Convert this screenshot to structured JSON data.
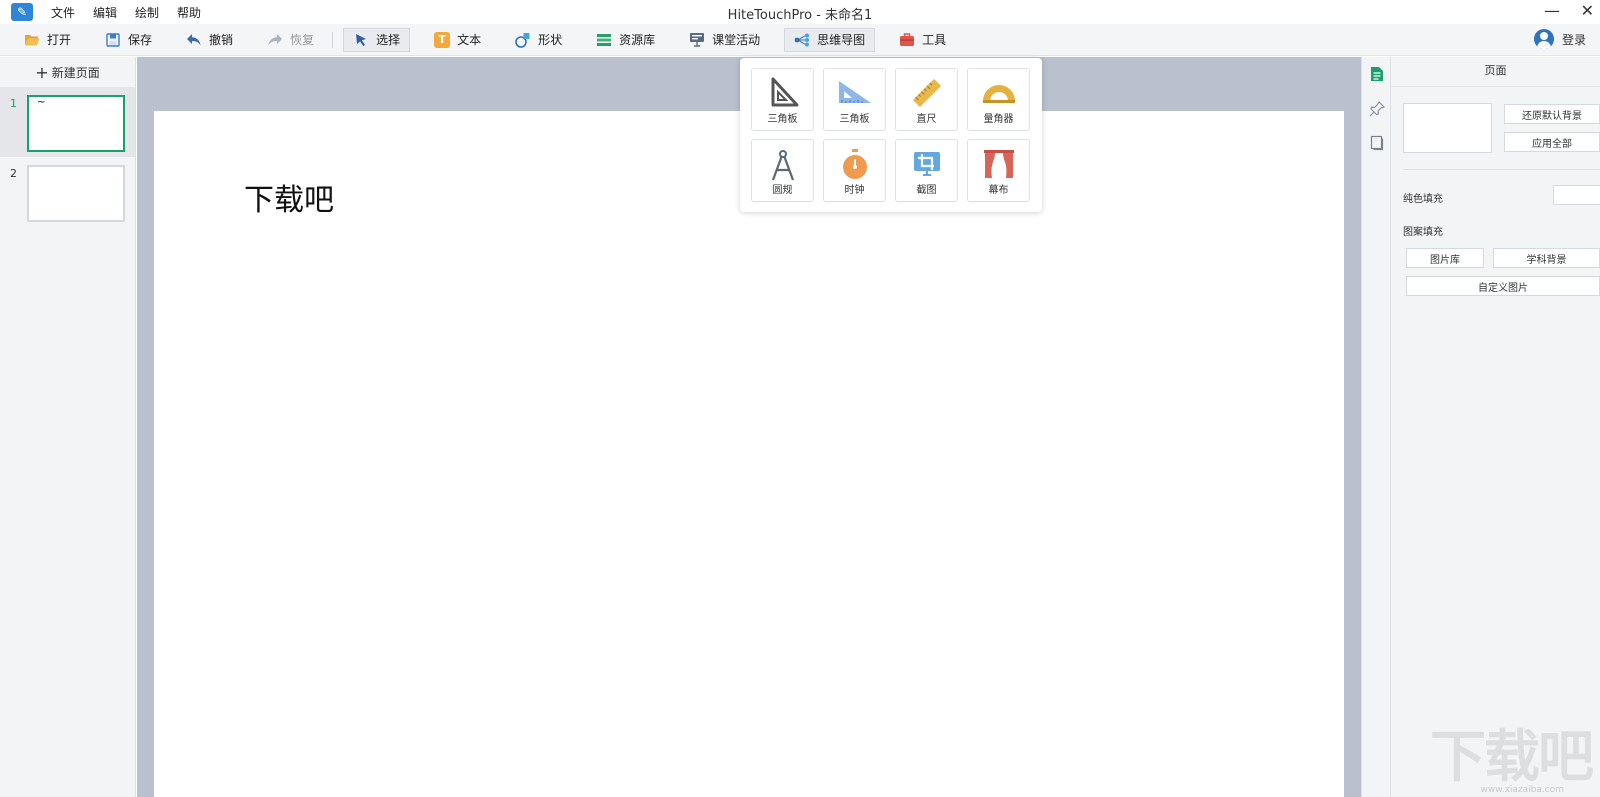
{
  "app": {
    "window_title": "HiteTouchPro - 未命名1",
    "logo_glyph": "✎"
  },
  "menu": [
    "文件",
    "编辑",
    "绘制",
    "帮助"
  ],
  "window_controls": {
    "minimize": "—",
    "close": "✕"
  },
  "toolbar": {
    "open": "打开",
    "save": "保存",
    "undo": "撤销",
    "redo": "恢复",
    "select": "选择",
    "text": "文本",
    "shape": "形状",
    "resources": "资源库",
    "classroom": "课堂活动",
    "mindmap": "思维导图",
    "tools": "工具",
    "login": "登录",
    "icon_text": "T"
  },
  "left_panel": {
    "new_page": "新建页面",
    "pages": [
      {
        "number": "1",
        "mark": "~",
        "selected": true
      },
      {
        "number": "2",
        "mark": "",
        "selected": false
      }
    ]
  },
  "slide": {
    "text": "下载吧"
  },
  "tools_popup": {
    "items": [
      {
        "label": "三角板",
        "icon": "set-square-icon"
      },
      {
        "label": "三角板",
        "icon": "ruler-triangle-icon"
      },
      {
        "label": "直尺",
        "icon": "ruler-icon"
      },
      {
        "label": "量角器",
        "icon": "protractor-icon"
      },
      {
        "label": "圆规",
        "icon": "compass-icon"
      },
      {
        "label": "时钟",
        "icon": "stopwatch-icon"
      },
      {
        "label": "截图",
        "icon": "screenshot-icon"
      },
      {
        "label": "幕布",
        "icon": "curtain-icon"
      }
    ]
  },
  "right_panel": {
    "title": "页面",
    "restore_default_bg": "还原默认背景",
    "apply_all": "应用全部",
    "solid_fill": "纯色填充",
    "pattern_fill": "图案填充",
    "image_library": "图片库",
    "subject_background": "学科背景",
    "custom_image": "自定义图片"
  },
  "watermark": {
    "text": "下载吧",
    "url": "www.xiazaiba.com"
  },
  "colors": {
    "accent_green": "#1aa06b",
    "workspace_bg": "#b9c0ce",
    "toolbar_bg": "#f4f5f7"
  }
}
